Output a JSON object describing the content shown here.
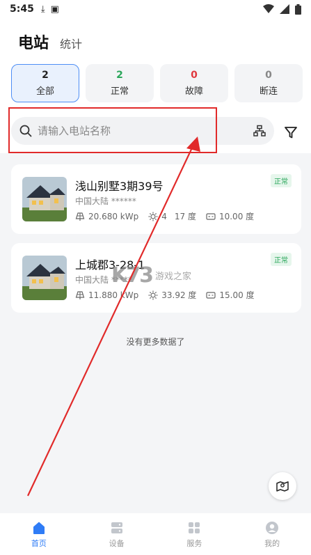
{
  "status_bar": {
    "time": "5:45"
  },
  "header": {
    "tab_active": "电站",
    "tab_inactive": "统计"
  },
  "filters": [
    {
      "count": "2",
      "label": "全部",
      "color": "#111111"
    },
    {
      "count": "2",
      "label": "正常",
      "color": "#2aa65a"
    },
    {
      "count": "0",
      "label": "故障",
      "color": "#e0383e"
    },
    {
      "count": "0",
      "label": "断连",
      "color": "#888888"
    }
  ],
  "search": {
    "placeholder": "请输入电站名称"
  },
  "stations": [
    {
      "name": "浅山别墅3期39号",
      "region": "中国大陆 ******",
      "capacity": "20.680 kWp",
      "energy": "4",
      "energy_suffix": "17 度",
      "today": "10.00 度",
      "status": "正常"
    },
    {
      "name": "上城郡3-28-1",
      "region": "中国大陆 *****",
      "capacity": "11.880 kWp",
      "energy": "33.92 度",
      "energy_suffix": "",
      "today": "15.00 度",
      "status": "正常"
    }
  ],
  "list_footer": "没有更多数据了",
  "watermark": "游戏之家",
  "tabbar": {
    "home": "首页",
    "devices": "设备",
    "service": "服务",
    "mine": "我的"
  },
  "accent_color": "#2f7cf6",
  "annotation_color": "#e12a2a"
}
